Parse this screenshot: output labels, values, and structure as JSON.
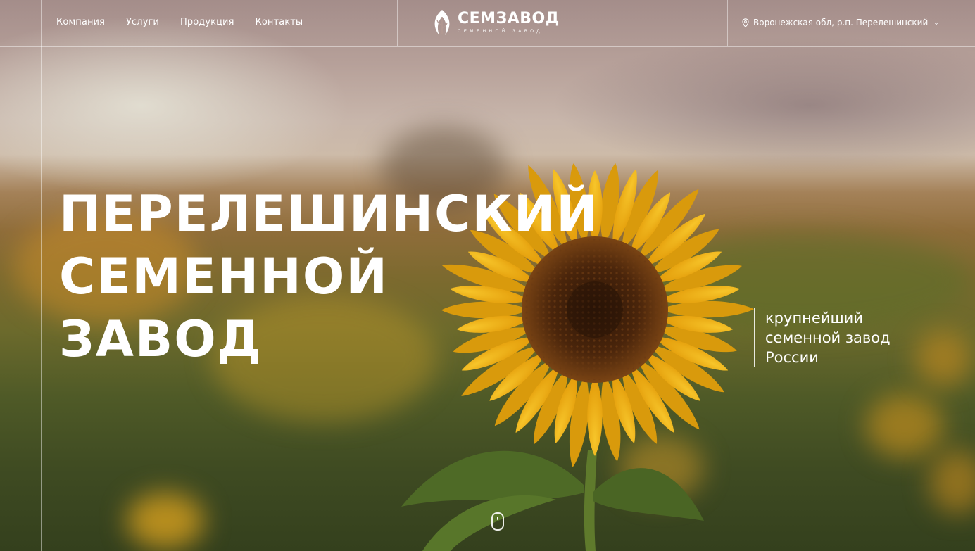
{
  "header": {
    "nav": [
      "Компания",
      "Услуги",
      "Продукция",
      "Контакты"
    ],
    "logo_name": "СЕМЗАВОД",
    "logo_subtitle": "СЕМЕННОЙ ЗАВОД",
    "location": "Воронежская обл, р.п. Перелешинский",
    "location_icon": "map-pin-icon"
  },
  "hero": {
    "title_lines": [
      "ПЕРЕЛЕШИНСКИЙ",
      "СЕМЕННОЙ",
      "ЗАВОД"
    ],
    "tagline_lines": [
      "крупнейший",
      "семенной завод",
      "России"
    ],
    "scroll_icon": "mouse-scroll-icon"
  },
  "colors": {
    "text": "#ffffff",
    "petal": "#f2b40f",
    "seed_center": "#5a2f10"
  }
}
